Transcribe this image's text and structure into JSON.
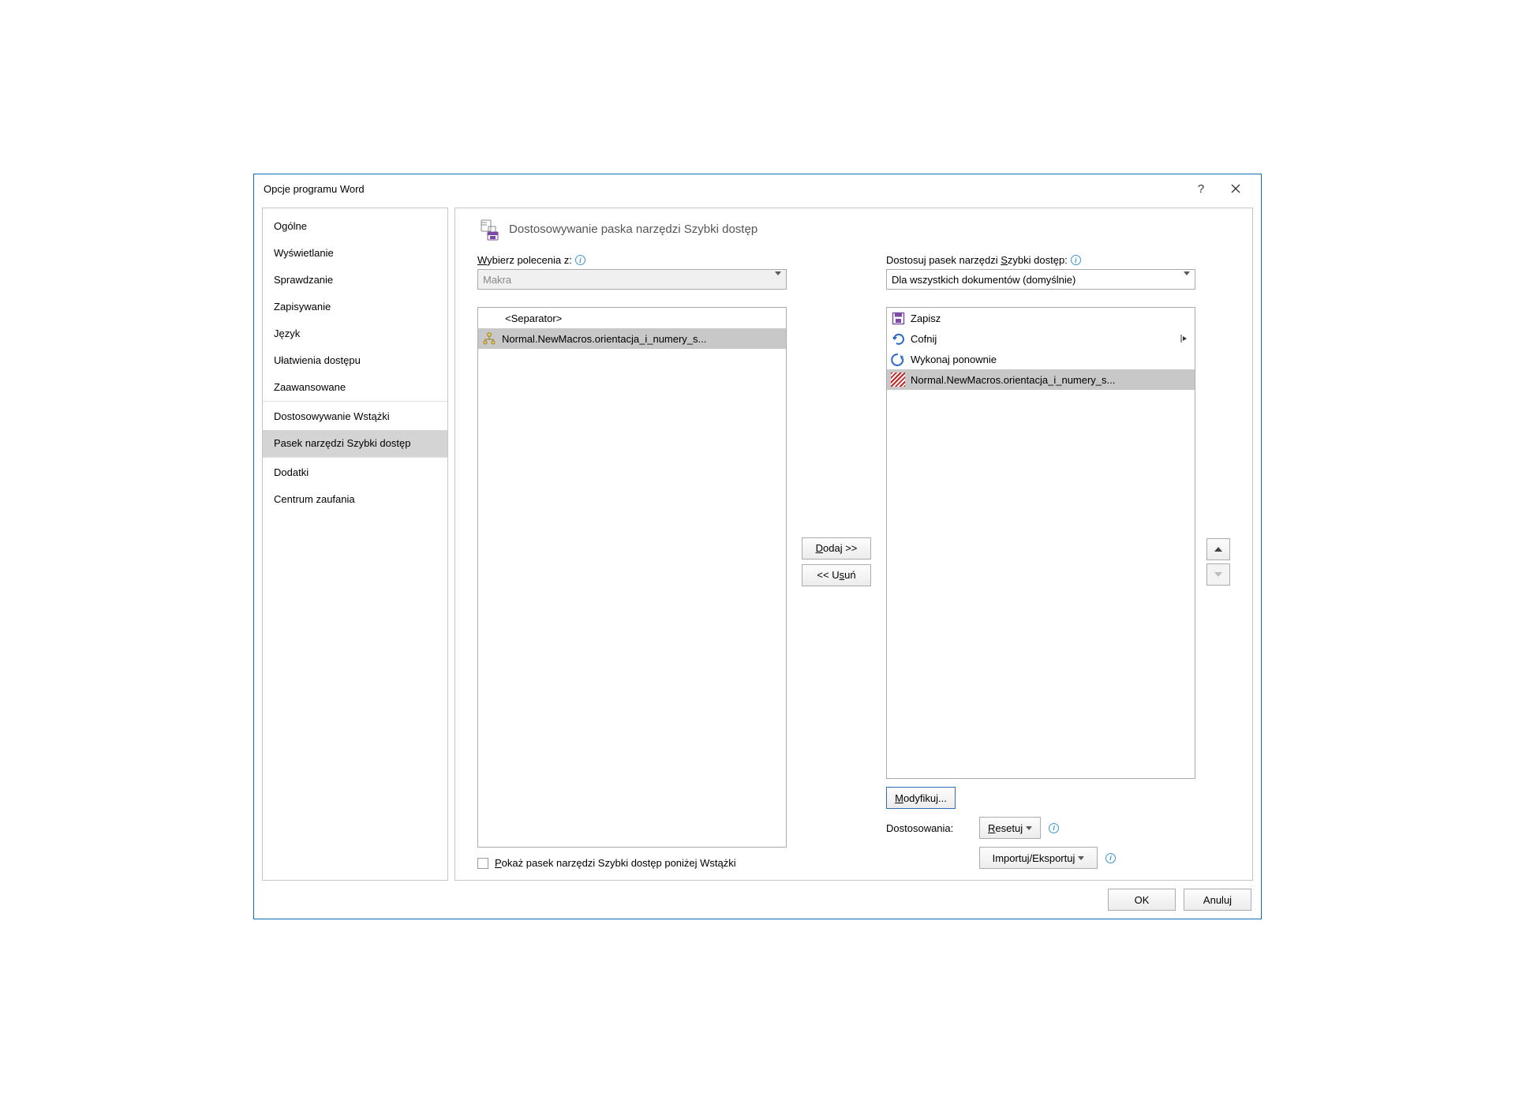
{
  "titlebar": {
    "title": "Opcje programu Word"
  },
  "sidebar": {
    "items": [
      {
        "label": "Ogólne"
      },
      {
        "label": "Wyświetlanie"
      },
      {
        "label": "Sprawdzanie"
      },
      {
        "label": "Zapisywanie"
      },
      {
        "label": "Język"
      },
      {
        "label": "Ułatwienia dostępu"
      },
      {
        "label": "Zaawansowane"
      },
      {
        "label": "Dostosowywanie Wstążki"
      },
      {
        "label": "Pasek narzędzi Szybki dostęp"
      },
      {
        "label": "Dodatki"
      },
      {
        "label": "Centrum zaufania"
      }
    ]
  },
  "heading": "Dostosowywanie paska narzędzi Szybki dostęp",
  "left": {
    "label_pre": "W",
    "label_rest": "ybierz polecenia z:",
    "combo": "Makra",
    "list": {
      "separator": "<Separator>",
      "macro": "Normal.NewMacros.orientacja_i_numery_s..."
    }
  },
  "mid": {
    "add_pre": "D",
    "add_rest": "odaj >>",
    "remove_pre": "<< U",
    "remove_u": "s",
    "remove_rest": "uń"
  },
  "right": {
    "label_pre": "Dostosuj pasek narzędzi ",
    "label_u": "S",
    "label_rest": "zybki dostęp:",
    "combo": "Dla wszystkich dokumentów (domyślnie)",
    "items": {
      "save": "Zapisz",
      "undo": "Cofnij",
      "redo": "Wykonaj ponownie",
      "macro": "Normal.NewMacros.orientacja_i_numery_s..."
    },
    "modify_u": "M",
    "modify_rest": "odyfikuj...",
    "custom_label": "Dostosowania:",
    "reset_u": "R",
    "reset_rest": "esetuj",
    "importexport": "Importuj/Eksportuj"
  },
  "below_left": {
    "chk_pre": "P",
    "chk_rest": "okaż pasek narzędzi Szybki dostęp poniżej Wstążki"
  },
  "footer": {
    "ok": "OK",
    "cancel": "Anuluj"
  }
}
